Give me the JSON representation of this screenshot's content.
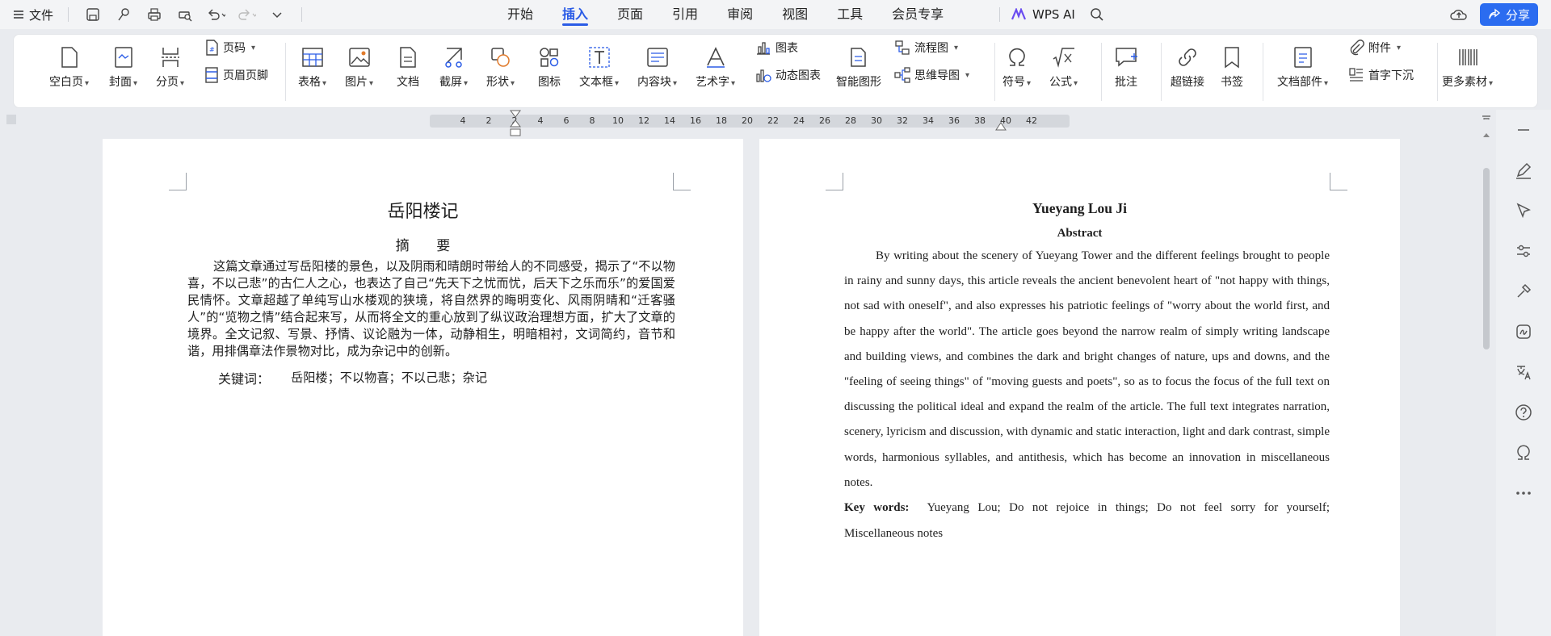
{
  "titlebar": {
    "menu": "文件",
    "wps_ai": "WPS AI",
    "share": "分享"
  },
  "tabs": [
    {
      "label": "开始"
    },
    {
      "label": "插入"
    },
    {
      "label": "页面"
    },
    {
      "label": "引用"
    },
    {
      "label": "审阅"
    },
    {
      "label": "视图"
    },
    {
      "label": "工具"
    },
    {
      "label": "会员专享"
    }
  ],
  "ribbon": {
    "blank_page": "空白页",
    "cover": "封面",
    "section": "分页",
    "page_number": "页码",
    "header_footer": "页眉页脚",
    "table": "表格",
    "picture": "图片",
    "document": "文档",
    "screenshot": "截屏",
    "shape": "形状",
    "icon": "图标",
    "textbox": "文本框",
    "content_block": "内容块",
    "wordart": "艺术字",
    "chart": "图表",
    "dynamic_chart": "动态图表",
    "smart_graphic": "智能图形",
    "flowchart": "流程图",
    "mindmap": "思维导图",
    "symbol": "符号",
    "formula": "公式",
    "comment": "批注",
    "hyperlink": "超链接",
    "bookmark": "书签",
    "doc_parts": "文档部件",
    "attachment": "附件",
    "drop_cap": "首字下沉",
    "more": "更多素材"
  },
  "ruler": {
    "ticks": [
      "4",
      "2",
      "2",
      "4",
      "6",
      "8",
      "10",
      "12",
      "14",
      "16",
      "18",
      "20",
      "22",
      "24",
      "26",
      "28",
      "30",
      "32",
      "34",
      "36",
      "38",
      "40",
      "42"
    ]
  },
  "doc_cn": {
    "title": "岳阳楼记",
    "abstract_heading": "摘 要",
    "body": "这篇文章通过写岳阳楼的景色，以及阴雨和晴朗时带给人的不同感受，揭示了“不以物喜，不以己悲”的古仁人之心，也表达了自己“先天下之忧而忧，后天下之乐而乐”的爱国爱民情怀。文章超越了单纯写山水楼观的狭境，将自然界的晦明变化、风雨阴晴和“迁客骚人”的“览物之情”结合起来写，从而将全文的重心放到了纵议政治理想方面，扩大了文章的境界。全文记叙、写景、抒情、议论融为一体，动静相生，明暗相衬，文词简约，音节和谐，用排偶章法作景物对比，成为杂记中的创新。",
    "keywords_label": "关键词：",
    "keywords": "岳阳楼；不以物喜；不以己悲；杂记"
  },
  "doc_en": {
    "title": "Yueyang Lou Ji",
    "abstract_heading": "Abstract",
    "body": "By writing about the scenery of Yueyang Tower and the different feelings brought to people in rainy and sunny days, this article reveals the ancient benevolent heart of \"not happy with things, not sad with oneself\", and also expresses his patriotic feelings of \"worry about the world first, and be happy after the world\". The article goes beyond the narrow realm of simply writing landscape and building views, and combines the dark and bright changes of nature, ups and downs, and the \"feeling of seeing things\" of \"moving guests and poets\", so as to focus the focus of the full text on discussing the political ideal and expand the realm of the article. The full text integrates narration, scenery, lyricism and discussion, with dynamic and static interaction, light and dark contrast, simple words, harmonious syllables, and antithesis, which has become an innovation in miscellaneous notes.",
    "keywords_label": "Key words:",
    "keywords": "Yueyang Lou; Do not rejoice in things; Do not feel sorry for yourself; Miscellaneous notes"
  },
  "colors": {
    "accent": "#2b5ce6",
    "share_bg": "#2b6cf0"
  }
}
